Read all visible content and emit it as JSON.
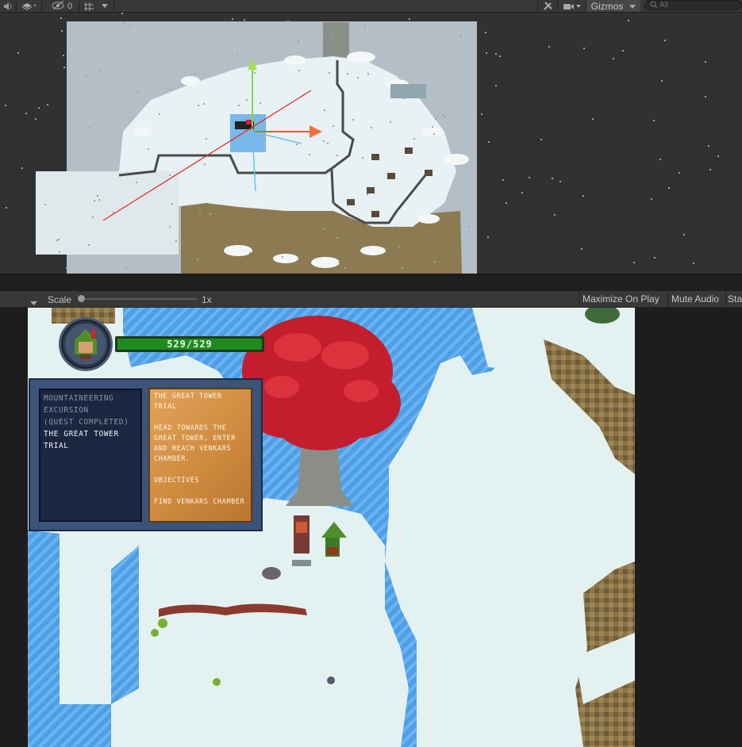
{
  "scene_toolbar": {
    "audio_icon": "speaker-icon",
    "layers_icon": "layers-icon",
    "hidden_icon": "eye-slash-icon",
    "hidden_count": "0",
    "grid_icon": "grid-icon",
    "tools_icon": "tools-icon",
    "camera_icon": "camera-icon",
    "gizmos_label": "Gizmos",
    "search_placeholder": "All"
  },
  "game_toolbar": {
    "scale_label": "Scale",
    "scale_value": "1x",
    "scale_fraction": 0.0,
    "buttons": {
      "maximize": "Maximize On Play",
      "mute": "Mute Audio",
      "stats": "Sta"
    }
  },
  "hud": {
    "hp_text": "529/529",
    "hp_fraction": 1.0,
    "quests": {
      "completed_title": "MOUNTAINEERING EXCURSION",
      "completed_status": "(QUEST COMPLETED)",
      "active_title": "THE GREAT TOWER TRIAL"
    },
    "detail": {
      "title": "THE GREAT TOWER TRIAL",
      "description": "HEAD TOWARDS THE GREAT TOWER, ENTER AND REACH VENKARS CHAMBER.",
      "objectives_label": "OBJECTIVES",
      "objective_1": "FIND VENKARS CHAMBER"
    }
  },
  "colors": {
    "editor_bg": "#282828",
    "toolbar_bg": "#383838",
    "water": "#4f9ee6",
    "snow": "#e4f1f1",
    "tree_red": "#c41e2e",
    "hp_green": "#1f8a1f"
  }
}
